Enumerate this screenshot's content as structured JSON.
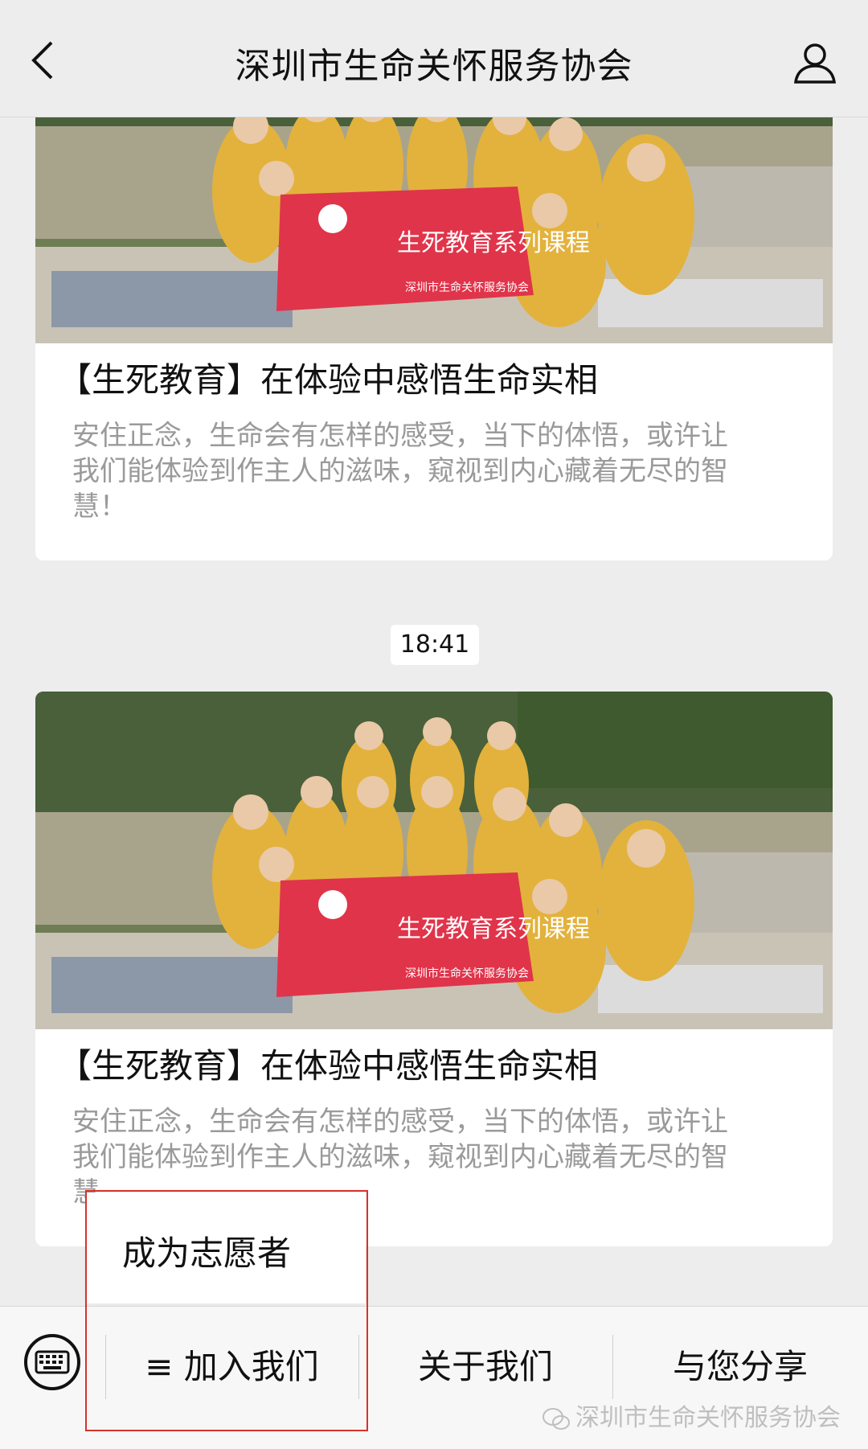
{
  "header": {
    "title": "深圳市生命关怀服务协会"
  },
  "feed": {
    "messages": [
      {
        "banner_text": "生死教育系列课程",
        "banner_org": "深圳市生命关怀服务协会",
        "title": "【生死教育】在体验中感悟生命实相",
        "desc_lines": [
          "安住正念，生命会有怎样的感受，当下的体悟，或许让",
          "我们能体验到作主人的滋味，窥视到内心藏着无尽的智",
          "慧！"
        ]
      },
      {
        "timestamp": "18:41",
        "banner_text": "生死教育系列课程",
        "banner_org": "深圳市生命关怀服务协会",
        "title": "【生死教育】在体验中感悟生命实相",
        "desc_lines": [
          "安住正念，生命会有怎样的感受，当下的体悟，或许让",
          "我们能体验到作主人的滋味，窥视到内心藏着无尽的智",
          "慧"
        ]
      }
    ]
  },
  "submenu": {
    "items": [
      "成为志愿者"
    ]
  },
  "menu": {
    "items": [
      "≡ 加入我们",
      "关于我们",
      "与您分享"
    ]
  },
  "watermark": {
    "text": "深圳市生命关怀服务协会"
  },
  "colors": {
    "background": "#ededed",
    "highlight": "#d9312b",
    "banner": "#e0344a",
    "scarf": "#e3b23c"
  },
  "icons": [
    "back-arrow-icon",
    "profile-icon",
    "keyboard-icon",
    "wechat-icon"
  ]
}
